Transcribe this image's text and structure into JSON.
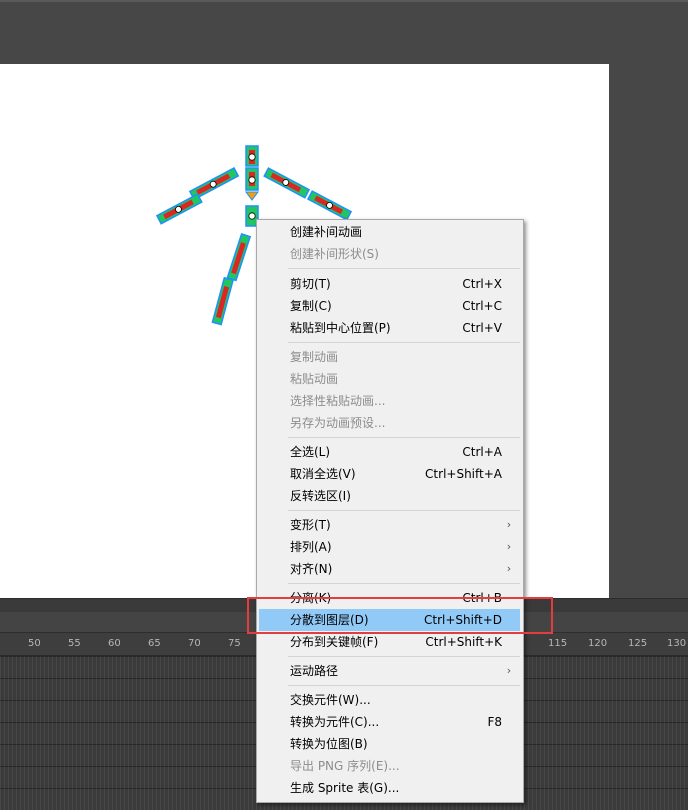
{
  "ruler": {
    "ticks": [
      "50",
      "55",
      "60",
      "65",
      "70",
      "75",
      "115",
      "120",
      "125",
      "130"
    ]
  },
  "context_menu": {
    "create_motion_tween": "创建补间动画",
    "create_shape_tween": "创建补间形状(S)",
    "cut": "剪切(T)",
    "cut_sc": "Ctrl+X",
    "copy": "复制(C)",
    "copy_sc": "Ctrl+C",
    "paste_center": "粘贴到中心位置(P)",
    "paste_center_sc": "Ctrl+V",
    "copy_motion": "复制动画",
    "paste_motion": "粘贴动画",
    "paste_motion_special": "选择性粘贴动画...",
    "save_motion_preset": "另存为动画预设...",
    "select_all": "全选(L)",
    "select_all_sc": "Ctrl+A",
    "deselect_all": "取消全选(V)",
    "deselect_all_sc": "Ctrl+Shift+A",
    "invert_selection": "反转选区(I)",
    "transform": "变形(T)",
    "arrange": "排列(A)",
    "align": "对齐(N)",
    "break_apart": "分离(K)",
    "break_apart_sc": "Ctrl+B",
    "distribute_layers": "分散到图层(D)",
    "distribute_layers_sc": "Ctrl+Shift+D",
    "distribute_keyframes": "分布到关键帧(F)",
    "distribute_keyframes_sc": "Ctrl+Shift+K",
    "motion_path": "运动路径",
    "swap_symbol": "交换元件(W)...",
    "convert_symbol": "转换为元件(C)...",
    "convert_symbol_sc": "F8",
    "convert_bitmap": "转换为位图(B)",
    "export_png": "导出 PNG 序列(E)...",
    "generate_sprite": "生成 Sprite 表(G)..."
  },
  "colors": {
    "highlight": "#91c9f7",
    "annotation": "#e43d3d",
    "selection": "#1e90ff"
  }
}
